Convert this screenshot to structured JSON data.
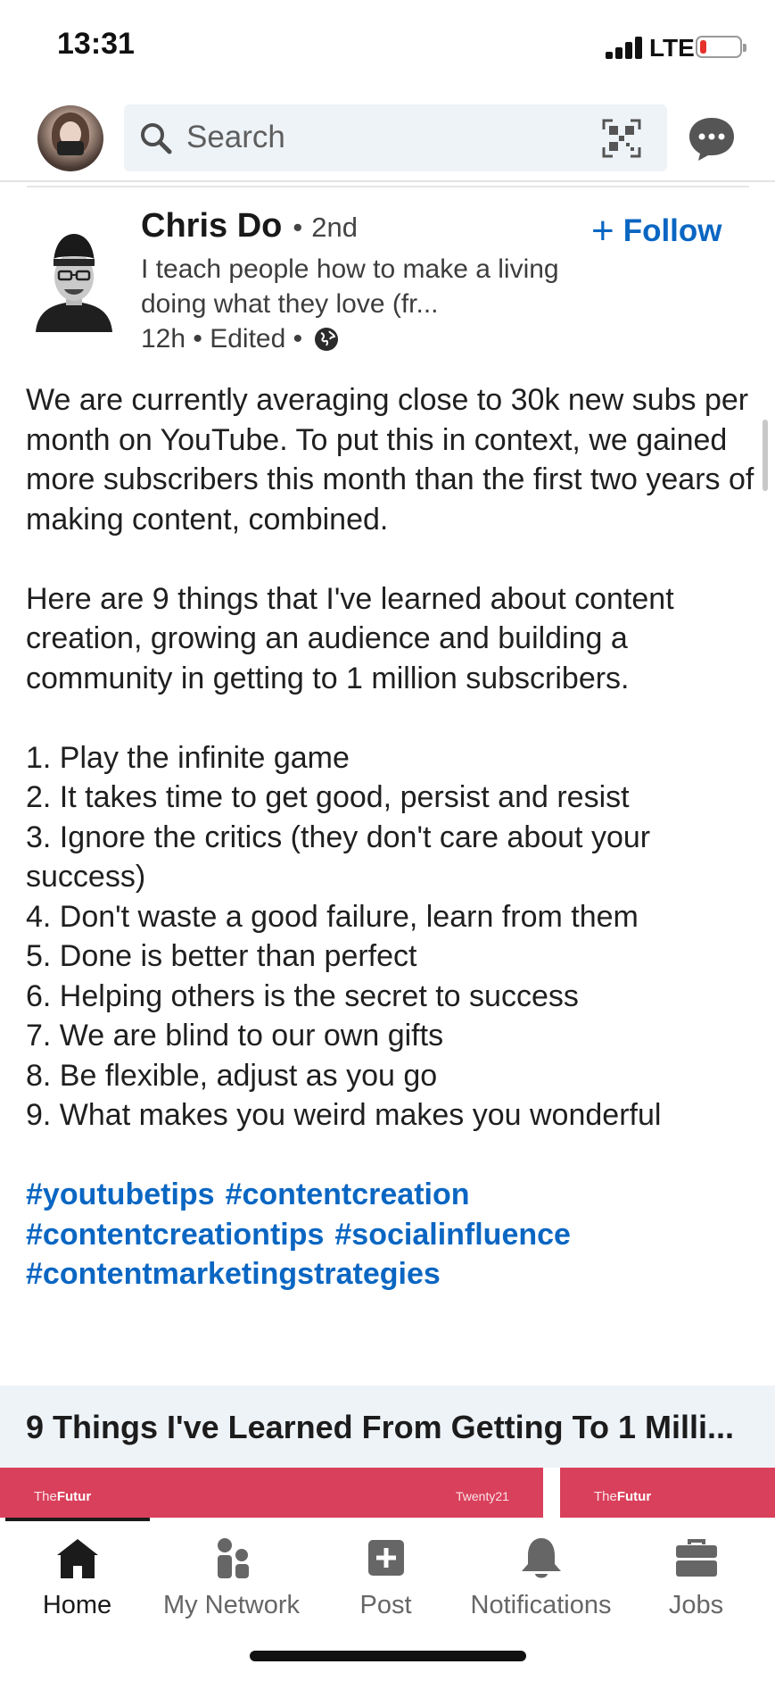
{
  "status": {
    "time": "13:31",
    "network": "LTE",
    "battery_level": 0.15
  },
  "header": {
    "search_placeholder": "Search"
  },
  "post": {
    "author": "Chris Do",
    "degree": "2nd",
    "follow_label": "Follow",
    "headline": "I teach people how to make a living doing what they love (fr...",
    "meta": "12h • Edited •",
    "body": {
      "p1": "We are currently averaging close to 30k new subs per month on YouTube. To put this in context, we gained more subscribers this month than the first two years of making content, combined.",
      "p2": "Here are 9 things that I've learned about content creation, growing an audience and building a community in getting to 1 million subscribers.",
      "list": [
        "1. Play the infinite game",
        "2. It takes time to get good, persist and resist",
        "3. Ignore the critics (they don't care about your success)",
        "4. Don't waste a good failure, learn from them",
        "5. Done is better than perfect",
        "6. Helping others is the secret to success",
        "7. We are blind to our own gifts",
        "8. Be flexible, adjust as you go",
        "9. What makes you weird makes you wonderful"
      ],
      "hashtags": [
        "#youtubetips",
        "#contentcreation",
        "#contentcreationtips",
        "#socialinfluence",
        "#contentmarketingstrategies"
      ]
    },
    "link_title": "9 Things I've Learned From Getting To 1 Milli...",
    "thumbnails": {
      "brand_prefix": "The",
      "brand_name": "Futur",
      "tag": "Twenty21"
    }
  },
  "tabs": [
    {
      "label": "Home",
      "icon": "home-icon"
    },
    {
      "label": "My Network",
      "icon": "network-icon"
    },
    {
      "label": "Post",
      "icon": "post-icon"
    },
    {
      "label": "Notifications",
      "icon": "bell-icon"
    },
    {
      "label": "Jobs",
      "icon": "briefcase-icon"
    }
  ],
  "colors": {
    "accent": "#0a66c2",
    "search_bg": "#eef3f8",
    "thumb": "#d9405b",
    "battery_low": "#e5322b"
  }
}
